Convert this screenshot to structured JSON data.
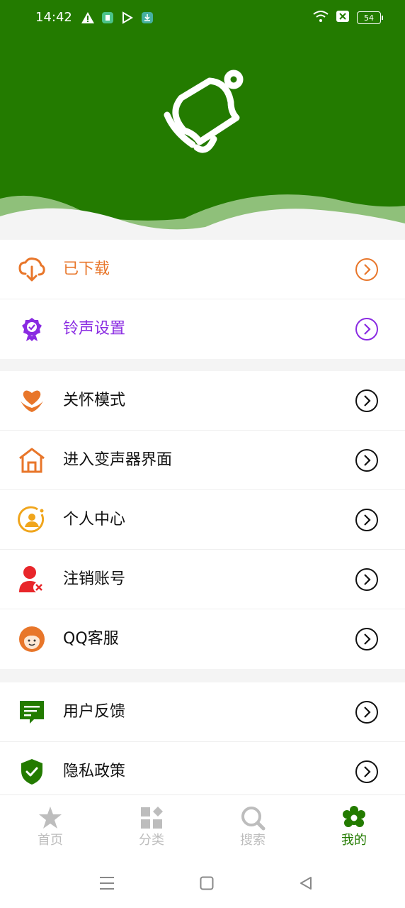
{
  "status_bar": {
    "time": "14:42",
    "battery": "54"
  },
  "colors": {
    "header_green": "#237b00",
    "orange": "#e8762a",
    "purple": "#8a2be2",
    "red": "#e8262a",
    "tab_inactive": "#bdbdbd"
  },
  "menu_group_1": [
    {
      "label": "已下载",
      "icon": "cloud-download-icon",
      "color": "#e8762a"
    },
    {
      "label": "铃声设置",
      "icon": "badge-icon",
      "color": "#8a2be2"
    }
  ],
  "menu_group_2": [
    {
      "label": "关怀模式",
      "icon": "heart-hands-icon"
    },
    {
      "label": "进入变声器界面",
      "icon": "house-icon"
    },
    {
      "label": "个人中心",
      "icon": "user-circle-icon"
    },
    {
      "label": "注销账号",
      "icon": "user-remove-icon"
    },
    {
      "label": "QQ客服",
      "icon": "support-agent-icon"
    }
  ],
  "menu_group_3": [
    {
      "label": "用户反馈",
      "icon": "feedback-icon"
    },
    {
      "label": "隐私政策",
      "icon": "shield-check-icon"
    }
  ],
  "tabs": [
    {
      "label": "首页",
      "icon": "star-icon",
      "active": false
    },
    {
      "label": "分类",
      "icon": "grid-icon",
      "active": false
    },
    {
      "label": "搜索",
      "icon": "search-icon",
      "active": false
    },
    {
      "label": "我的",
      "icon": "flower-gear-icon",
      "active": true
    }
  ]
}
